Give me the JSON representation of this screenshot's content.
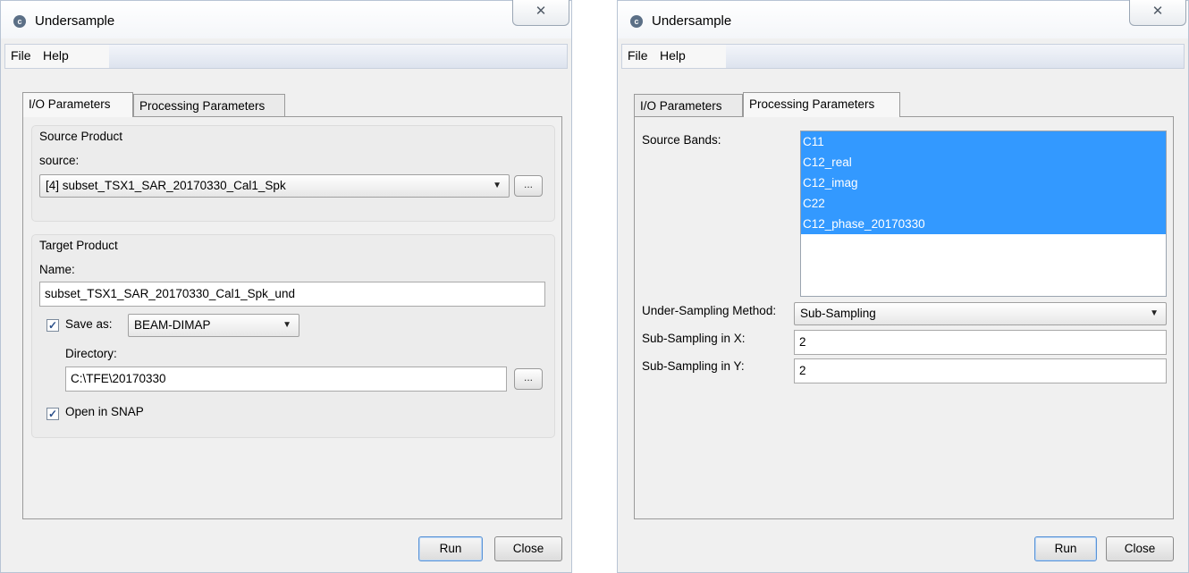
{
  "left": {
    "title": "Undersample",
    "close_symbol": "✕",
    "menu": {
      "file": "File",
      "help": "Help"
    },
    "tabs": [
      "I/O Parameters",
      "Processing Parameters"
    ],
    "source_group": "Source Product",
    "source_label": "source:",
    "source_value": "[4] subset_TSX1_SAR_20170330_Cal1_Spk",
    "browse_label": "...",
    "target_group": "Target Product",
    "name_label": "Name:",
    "name_value": "subset_TSX1_SAR_20170330_Cal1_Spk_und",
    "save_as_label": "Save as:",
    "save_as_checked": true,
    "format_value": "BEAM-DIMAP",
    "directory_label": "Directory:",
    "directory_value": "C:\\TFE\\20170330",
    "open_in_snap_label": "Open in SNAP",
    "open_in_snap_checked": true,
    "run_label": "Run",
    "close_label": "Close"
  },
  "right": {
    "title": "Undersample",
    "close_symbol": "✕",
    "menu": {
      "file": "File",
      "help": "Help"
    },
    "tabs": [
      "I/O Parameters",
      "Processing Parameters"
    ],
    "source_bands_label": "Source Bands:",
    "bands": [
      "C11",
      "C12_real",
      "C12_imag",
      "C22",
      "C12_phase_20170330"
    ],
    "method_label": "Under-Sampling Method:",
    "method_value": "Sub-Sampling",
    "subx_label": "Sub-Sampling in X:",
    "subx_value": "2",
    "suby_label": "Sub-Sampling in Y:",
    "suby_value": "2",
    "run_label": "Run",
    "close_label": "Close"
  }
}
